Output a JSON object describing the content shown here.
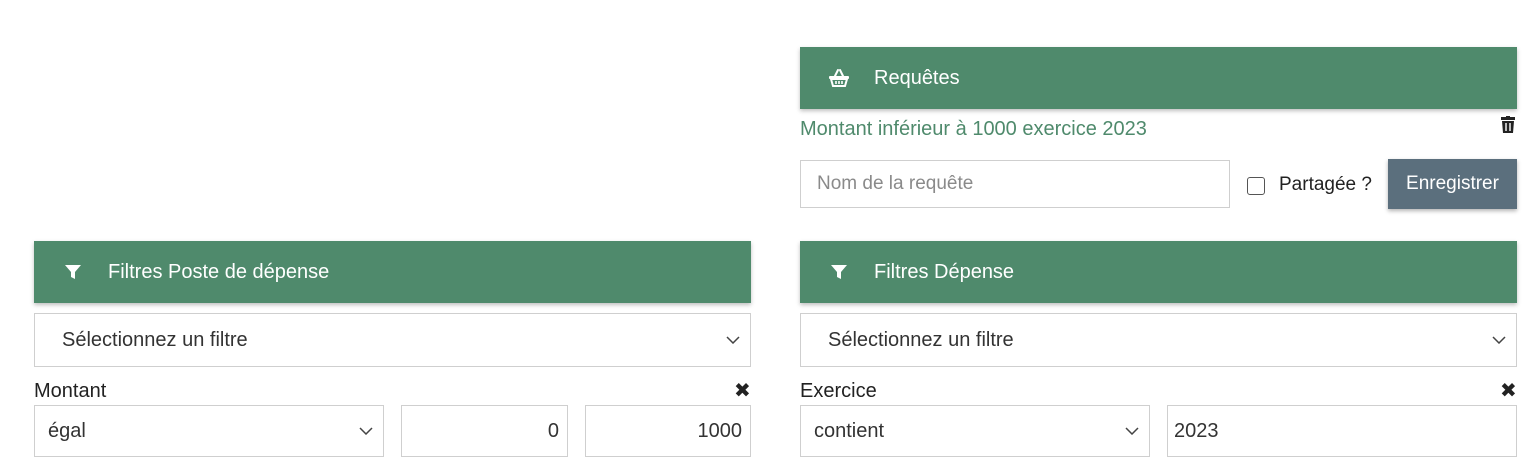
{
  "requetes": {
    "title": "Requêtes",
    "icon": "basket-icon",
    "saved_query": "Montant inférieur à 1000 exercice 2023",
    "name_placeholder": "Nom de la requête",
    "shared_label": "Partagée ?",
    "shared_checked": false,
    "save_label": "Enregistrer"
  },
  "filtres_poste": {
    "title": "Filtres Poste de dépense",
    "icon": "filter-icon",
    "select_placeholder": "Sélectionnez un filtre",
    "filter": {
      "label": "Montant",
      "operator": "égal",
      "min_value": "0",
      "max_value": "1000"
    }
  },
  "filtres_depense": {
    "title": "Filtres Dépense",
    "icon": "filter-icon",
    "select_placeholder": "Sélectionnez un filtre",
    "filter": {
      "label": "Exercice",
      "operator": "contient",
      "value": "2023"
    }
  },
  "colors": {
    "header_green": "#4f8a6c",
    "button_slate": "#5b6f7d",
    "link_green": "#4f8a6c"
  }
}
